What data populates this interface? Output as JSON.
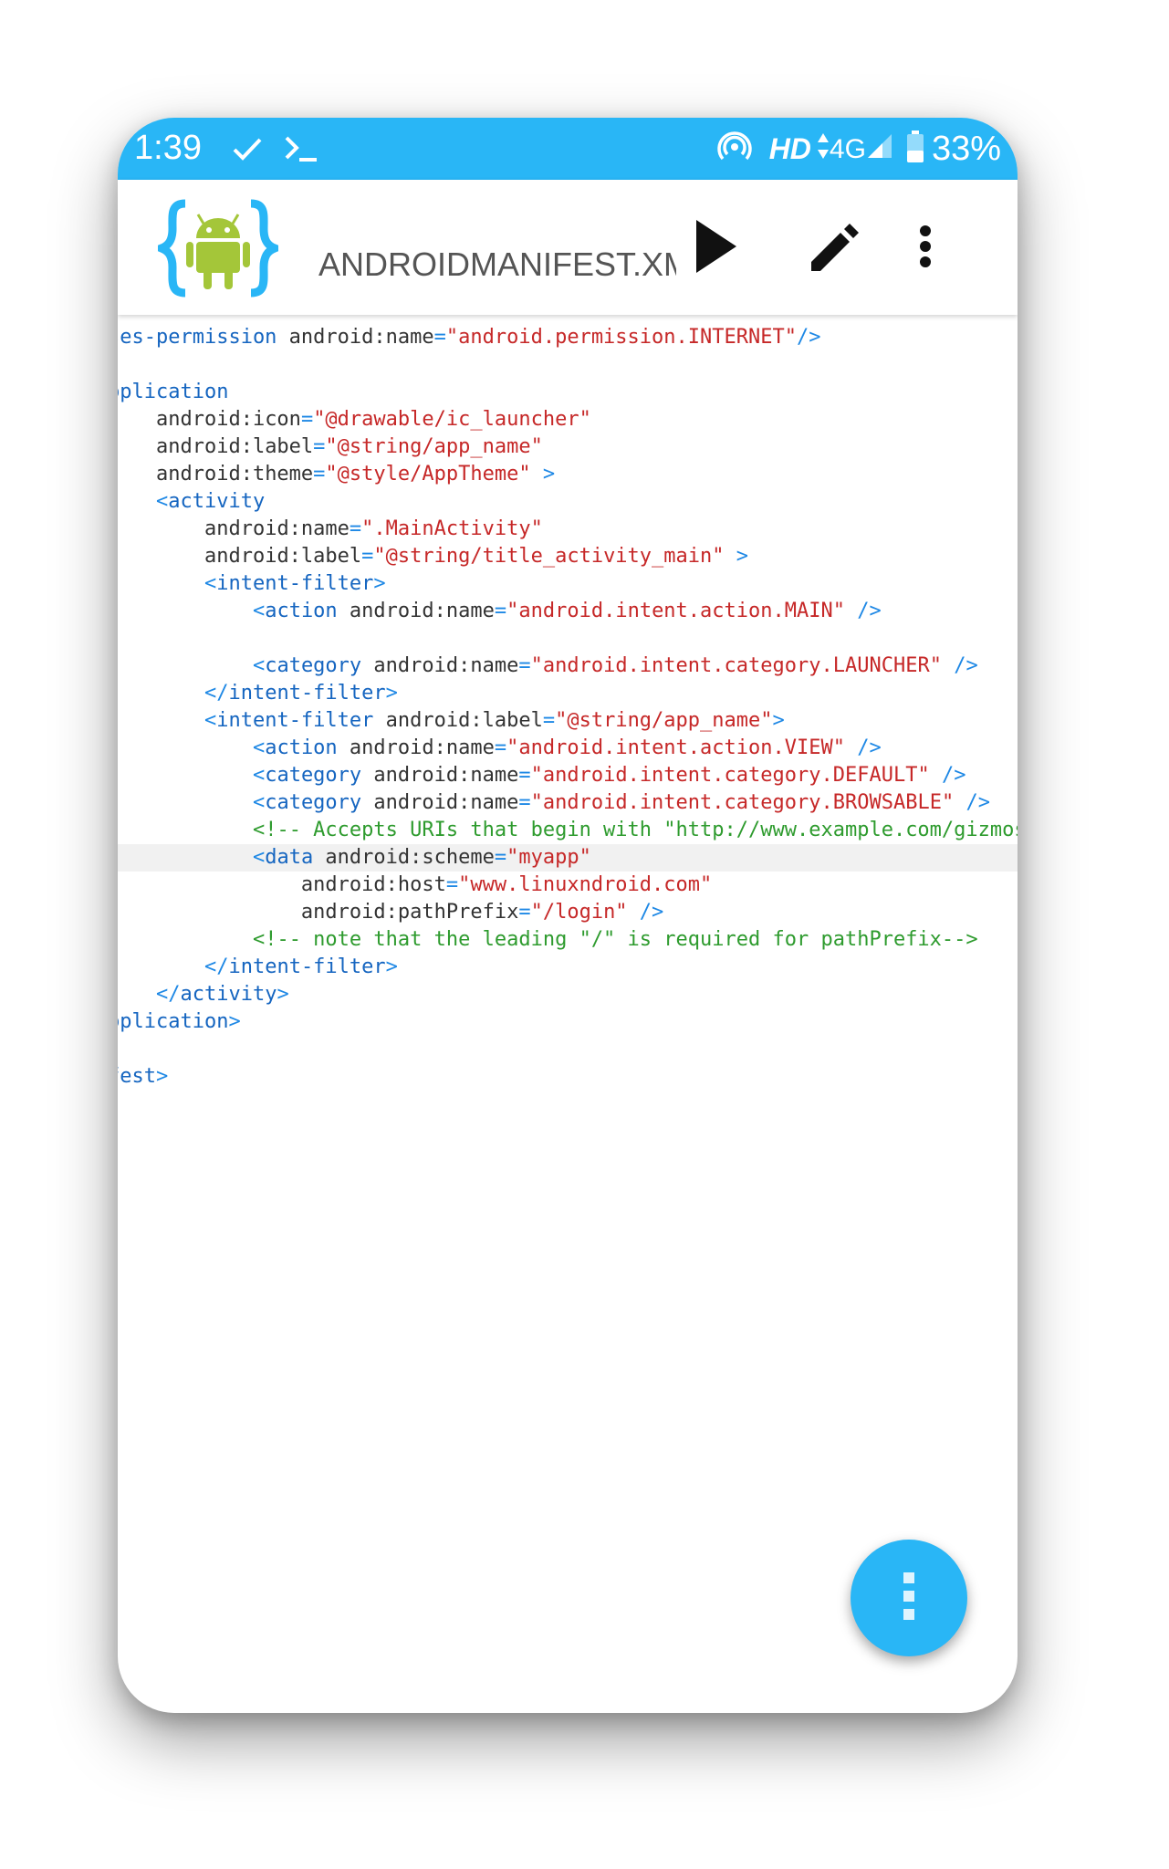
{
  "status_bar": {
    "time": "1:39",
    "hd": "HD",
    "network": "4G",
    "battery": "33%",
    "icons": [
      "check-icon",
      "terminal-icon",
      "hotspot-icon",
      "data-arrows-icon",
      "signal-icon",
      "battery-icon"
    ]
  },
  "app_bar": {
    "title": "ANDROIDMANIFEST.XML",
    "actions": [
      "play-icon",
      "edit-pencil-icon",
      "more-vert-icon"
    ]
  },
  "code_lines": [
    {
      "indent": "",
      "tokens": [
        [
          "t-tag",
          "ses-permission"
        ],
        [
          "t-attr",
          " android:name"
        ],
        [
          "t-p",
          "="
        ],
        [
          "t-str",
          "\"android.permission.INTERNET\""
        ],
        [
          "t-p",
          "/>"
        ]
      ]
    },
    {
      "indent": "",
      "tokens": []
    },
    {
      "indent": "",
      "tokens": [
        [
          "t-tag",
          "pplication"
        ]
      ]
    },
    {
      "indent": "    ",
      "tokens": [
        [
          "t-attr",
          "android:icon"
        ],
        [
          "t-p",
          "="
        ],
        [
          "t-str",
          "\"@drawable/ic_launcher\""
        ]
      ]
    },
    {
      "indent": "    ",
      "tokens": [
        [
          "t-attr",
          "android:label"
        ],
        [
          "t-p",
          "="
        ],
        [
          "t-str",
          "\"@string/app_name\""
        ]
      ]
    },
    {
      "indent": "    ",
      "tokens": [
        [
          "t-attr",
          "android:theme"
        ],
        [
          "t-p",
          "="
        ],
        [
          "t-str",
          "\"@style/AppTheme\""
        ],
        [
          "t-p",
          " >"
        ]
      ]
    },
    {
      "indent": "    ",
      "tokens": [
        [
          "t-p",
          "<"
        ],
        [
          "t-tag",
          "activity"
        ]
      ]
    },
    {
      "indent": "        ",
      "tokens": [
        [
          "t-attr",
          "android:name"
        ],
        [
          "t-p",
          "="
        ],
        [
          "t-str",
          "\".MainActivity\""
        ]
      ]
    },
    {
      "indent": "        ",
      "tokens": [
        [
          "t-attr",
          "android:label"
        ],
        [
          "t-p",
          "="
        ],
        [
          "t-str",
          "\"@string/title_activity_main\""
        ],
        [
          "t-p",
          " >"
        ]
      ]
    },
    {
      "indent": "        ",
      "tokens": [
        [
          "t-p",
          "<"
        ],
        [
          "t-tag",
          "intent-filter"
        ],
        [
          "t-p",
          ">"
        ]
      ]
    },
    {
      "indent": "            ",
      "tokens": [
        [
          "t-p",
          "<"
        ],
        [
          "t-tag",
          "action"
        ],
        [
          "t-attr",
          " android:name"
        ],
        [
          "t-p",
          "="
        ],
        [
          "t-str",
          "\"android.intent.action.MAIN\""
        ],
        [
          "t-p",
          " />"
        ]
      ]
    },
    {
      "indent": "",
      "tokens": []
    },
    {
      "indent": "            ",
      "tokens": [
        [
          "t-p",
          "<"
        ],
        [
          "t-tag",
          "category"
        ],
        [
          "t-attr",
          " android:name"
        ],
        [
          "t-p",
          "="
        ],
        [
          "t-str",
          "\"android.intent.category.LAUNCHER\""
        ],
        [
          "t-p",
          " />"
        ]
      ]
    },
    {
      "indent": "        ",
      "tokens": [
        [
          "t-p",
          "</"
        ],
        [
          "t-tag",
          "intent-filter"
        ],
        [
          "t-p",
          ">"
        ]
      ]
    },
    {
      "indent": "        ",
      "tokens": [
        [
          "t-p",
          "<"
        ],
        [
          "t-tag",
          "intent-filter"
        ],
        [
          "t-attr",
          " android:label"
        ],
        [
          "t-p",
          "="
        ],
        [
          "t-str",
          "\"@string/app_name\""
        ],
        [
          "t-p",
          ">"
        ]
      ]
    },
    {
      "indent": "            ",
      "tokens": [
        [
          "t-p",
          "<"
        ],
        [
          "t-tag",
          "action"
        ],
        [
          "t-attr",
          " android:name"
        ],
        [
          "t-p",
          "="
        ],
        [
          "t-str",
          "\"android.intent.action.VIEW\""
        ],
        [
          "t-p",
          " />"
        ]
      ]
    },
    {
      "indent": "            ",
      "tokens": [
        [
          "t-p",
          "<"
        ],
        [
          "t-tag",
          "category"
        ],
        [
          "t-attr",
          " android:name"
        ],
        [
          "t-p",
          "="
        ],
        [
          "t-str",
          "\"android.intent.category.DEFAULT\""
        ],
        [
          "t-p",
          " />"
        ]
      ]
    },
    {
      "indent": "            ",
      "tokens": [
        [
          "t-p",
          "<"
        ],
        [
          "t-tag",
          "category"
        ],
        [
          "t-attr",
          " android:name"
        ],
        [
          "t-p",
          "="
        ],
        [
          "t-str",
          "\"android.intent.category.BROWSABLE\""
        ],
        [
          "t-p",
          " />"
        ]
      ]
    },
    {
      "indent": "            ",
      "tokens": [
        [
          "t-com",
          "<!-- Accepts URIs that begin with \"http://www.example.com/gizmos"
        ]
      ]
    },
    {
      "indent": "            ",
      "highlight": true,
      "tokens": [
        [
          "t-p",
          "<"
        ],
        [
          "t-tag",
          "data"
        ],
        [
          "t-attr",
          " android:scheme"
        ],
        [
          "t-p",
          "="
        ],
        [
          "t-str",
          "\"myapp\""
        ]
      ]
    },
    {
      "indent": "                ",
      "tokens": [
        [
          "t-attr",
          "android:host"
        ],
        [
          "t-p",
          "="
        ],
        [
          "t-str",
          "\"www.linuxndroid.com\""
        ]
      ]
    },
    {
      "indent": "                ",
      "tokens": [
        [
          "t-attr",
          "android:pathPrefix"
        ],
        [
          "t-p",
          "="
        ],
        [
          "t-str",
          "\"/login\""
        ],
        [
          "t-p",
          " />"
        ]
      ]
    },
    {
      "indent": "            ",
      "tokens": [
        [
          "t-com",
          "<!-- note that the leading \"/\" is required for pathPrefix-->"
        ]
      ]
    },
    {
      "indent": "        ",
      "tokens": [
        [
          "t-p",
          "</"
        ],
        [
          "t-tag",
          "intent-filter"
        ],
        [
          "t-p",
          ">"
        ]
      ]
    },
    {
      "indent": "    ",
      "tokens": [
        [
          "t-p",
          "</"
        ],
        [
          "t-tag",
          "activity"
        ],
        [
          "t-p",
          ">"
        ]
      ]
    },
    {
      "indent": "",
      "tokens": [
        [
          "t-tag",
          "pplication"
        ],
        [
          "t-p",
          ">"
        ]
      ]
    },
    {
      "indent": "",
      "tokens": []
    },
    {
      "indent": "",
      "tokens": [
        [
          "t-tag",
          "fest"
        ],
        [
          "t-p",
          ">"
        ]
      ]
    }
  ],
  "fab": {
    "icon": "more-vert-icon"
  },
  "colors": {
    "accent": "#29b6f6",
    "tag": "#1565c0",
    "string": "#c62828",
    "comment": "#2e9b2e",
    "android_green": "#a4c639"
  }
}
